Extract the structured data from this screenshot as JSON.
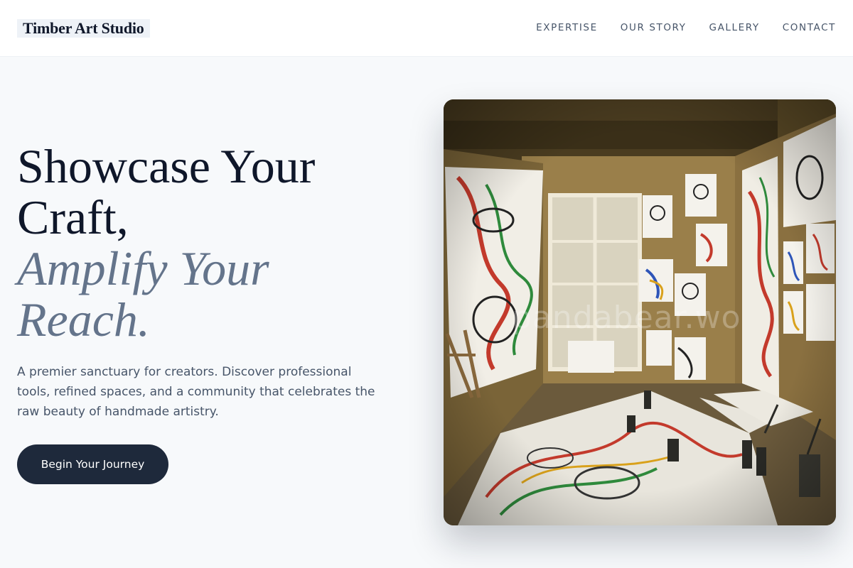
{
  "header": {
    "logo": "Timber Art Studio",
    "nav": [
      "EXPERTISE",
      "OUR STORY",
      "GALLERY",
      "CONTACT"
    ]
  },
  "hero": {
    "title_line1": "Showcase Your",
    "title_line2": "Craft,",
    "title_accent_line1": "Amplify Your",
    "title_accent_line2": "Reach.",
    "description": "A premier sanctuary for creators. Discover professional tools, refined spaces, and a community that celebrates the raw beauty of handmade artistry.",
    "cta_label": "Begin Your Journey"
  },
  "image": {
    "watermark": "pandabear.wo"
  },
  "colors": {
    "background": "#f7f9fb",
    "heading": "#0f172a",
    "accent_text": "#64748b",
    "body_text": "#475569",
    "button": "#1e293b"
  }
}
